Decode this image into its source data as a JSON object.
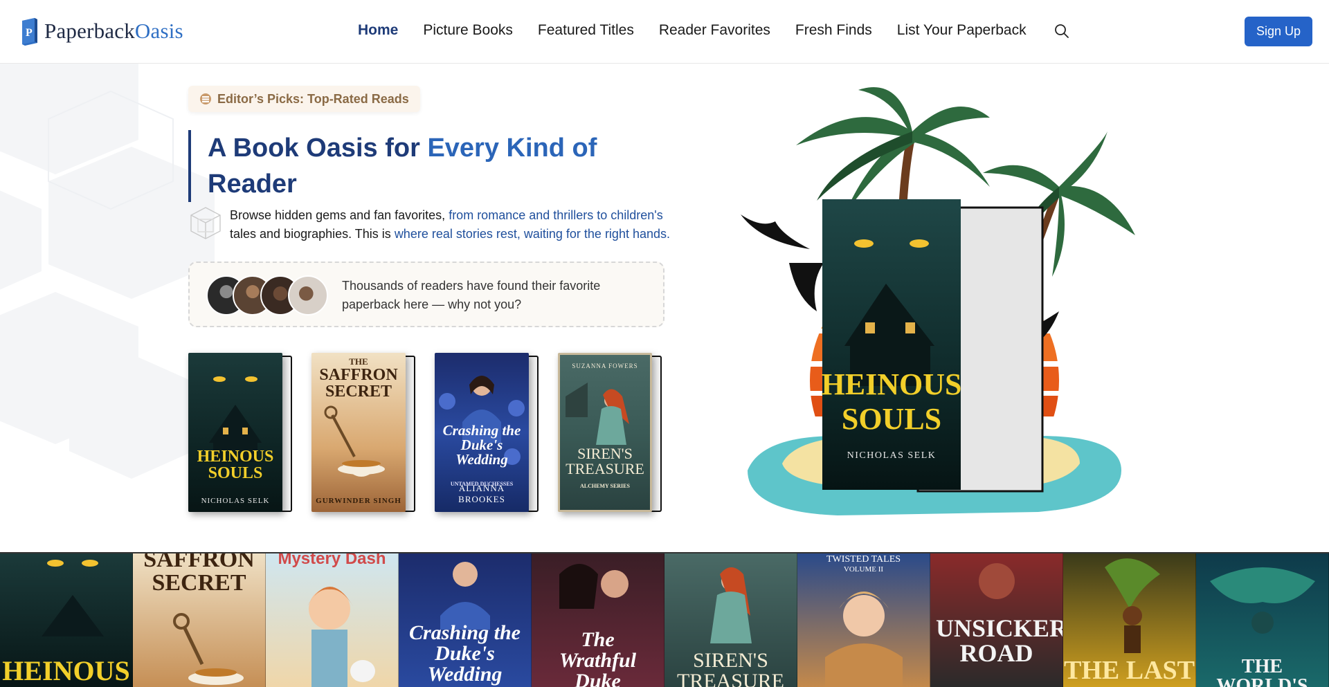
{
  "nav": {
    "logo_part1": "Paperback",
    "logo_part2": "Oasis",
    "items": [
      {
        "label": "Home",
        "active": true
      },
      {
        "label": "Picture Books"
      },
      {
        "label": "Featured Titles"
      },
      {
        "label": "Reader Favorites"
      },
      {
        "label": "Fresh Finds"
      },
      {
        "label": "List Your Paperback"
      }
    ],
    "search_icon": "search-icon",
    "signup_label": "Sign Up"
  },
  "hero": {
    "badge": "Editor’s Picks: Top-Rated Reads",
    "headline_part1": "A Book Oasis for ",
    "headline_part2": "Every Kind of",
    "headline_part3": "Reader",
    "desc_part1": "Browse hidden gems and fan favorites, ",
    "desc_part2": "from romance and thrillers to children's",
    "desc_part3": "tales and biographies. This is ",
    "desc_part4": "where real stories rest, waiting for the right hands.",
    "social_text": "Thousands of readers have found their favorite paperback here — why not you?",
    "books": [
      {
        "title_top": "",
        "title": "HEINOUS SOULS",
        "author": "NICHOLAS SELK"
      },
      {
        "title_top": "THE",
        "title": "SAFFRON SECRET",
        "author": "GURWINDER SINGH"
      },
      {
        "title_top": "",
        "title": "Crashing the Duke's Wedding",
        "subtitle": "UNTAMED DUCHESSES",
        "author": "ALIANNA BROOKES"
      },
      {
        "title_top": "SUZANNA FOWERS",
        "title": "SIREN'S TREASURE",
        "subtitle": "ALCHEMY SERIES",
        "author": ""
      }
    ],
    "featured": {
      "title_line1": "HEINOUS",
      "title_line2": "SOULS",
      "author": "NICHOLAS SELK"
    }
  },
  "strip": [
    {
      "title": "HEINOUS"
    },
    {
      "title": "SAFFRON SECRET"
    },
    {
      "title": "Mystery Dash"
    },
    {
      "title": "Crashing the Duke's Wedding"
    },
    {
      "title": "The Wrathful Duke"
    },
    {
      "title": "SIREN'S TREASURE"
    },
    {
      "title": "TWISTED TALES",
      "subtitle": "VOLUME II"
    },
    {
      "title": "UNSICKER ROAD"
    },
    {
      "title": "THE LAST"
    },
    {
      "title": "THE WORLD'S"
    }
  ],
  "colors": {
    "brand_dark": "#1e3b78",
    "brand_blue": "#2f6fc4",
    "signup_bg": "#2563c8",
    "badge_text": "#8a6a45"
  }
}
